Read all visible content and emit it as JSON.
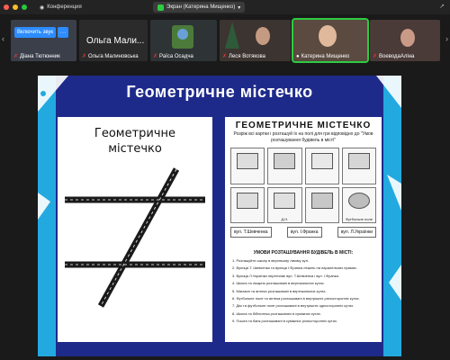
{
  "window": {
    "app_title": "Конференция",
    "screen_label": "Экран (Катерина Мищенко)"
  },
  "gallery": {
    "unmute_label": "Включить звук",
    "participants": [
      {
        "name": "Діана Тютюнник",
        "muted": true
      },
      {
        "name": "Ольга Малиновська",
        "display": "Ольга Мали...",
        "muted": true
      },
      {
        "name": "Раїса Осадча",
        "muted": true
      },
      {
        "name": "Леся Вотякова",
        "muted": true
      },
      {
        "name": "Катерина Мищенко",
        "muted": false,
        "active": true
      },
      {
        "name": "ВоеводаАліна",
        "muted": true
      }
    ]
  },
  "slide": {
    "title": "Геометричне містечко",
    "left_panel_title_line1": "Геометричне",
    "left_panel_title_line2": "містечко",
    "right_panel_title": "ГЕОМЕТРИЧНЕ МІСТЕЧКО",
    "right_panel_subtitle": "Розріж всі картки і розташуй їх на полі для гри відповідно до \"Умов розташування будівель в місті\"",
    "cards": [
      {
        "label": ""
      },
      {
        "label": ""
      },
      {
        "label": ""
      },
      {
        "label": ""
      },
      {
        "label": ""
      },
      {
        "label": "Д.Н."
      },
      {
        "label": ""
      },
      {
        "label": "Футбольне поле"
      }
    ],
    "streets": [
      "вул. Т.Шевченка",
      "вул. І.Франка",
      "вул. Л.Українки"
    ],
    "rules_heading": "УМОВИ РОЗТАШУВАННЯ БУДІВЕЛЬ В МІСТІ:",
    "rules": [
      "1. Розташуйте школу в верхньому лівому куті.",
      "2. Вулиця Т. Шевченка та вулиця І.Франка лежать на паралельних прямих.",
      "3. Вулиця Л.Українки перетинає вул. Т.Шевченка і вул. І.Франка.",
      "4. Школа та лікарня розташовані в вертикальних кутах.",
      "5. Магазин та аптека розташовані в вертикальних кутах.",
      "6. Футбольне поле та аптека розташовані в внутрішніх різносторонніх кутах.",
      "7. Дім та футбольне поле розташовані в внутрішніх односторонніх кутах.",
      "8. Школа та бібліотека розташовані в суміжних кутах.",
      "9. Пошта та банк розташовані в суміжних різносторонніх кутах."
    ]
  },
  "colors": {
    "slide_navy": "#1e2a8a",
    "slide_cyan": "#22a9e0",
    "zoom_blue": "#2d8cff",
    "active_green": "#2ecc40",
    "mute_red": "#e53935"
  }
}
